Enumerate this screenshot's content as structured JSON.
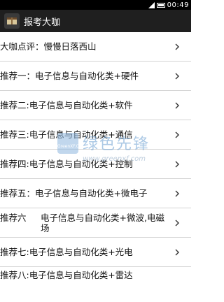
{
  "status_bar": {
    "time": "00:49"
  },
  "action_bar": {
    "title": "报考大咖"
  },
  "list": {
    "items": [
      {
        "label": "大咖点评：慢慢日落西山"
      },
      {
        "label": "推荐一：电子信息与自动化类+硬件"
      },
      {
        "label": "推荐二:电子信息与自动化类+软件"
      },
      {
        "label": "推荐三:电子信息与自动化类+通信"
      },
      {
        "label": "推荐四:电子信息与自动化类+控制"
      },
      {
        "label": "推荐五：电子信息与自动化类+微电子"
      },
      {
        "label_left": "推荐六",
        "label_right": "电子信息与自动化类+微波,电磁场"
      },
      {
        "label": "推荐七:电子信息与自动化类+光电"
      },
      {
        "label": "推荐八:电子信息与自动化类+雷达"
      }
    ]
  },
  "watermark": {
    "title": "绿色先锋",
    "url": "www.greenxf.com",
    "logo_text": "GreenXF.COM"
  },
  "icons": {
    "chevron": "chevron-right-icon",
    "app": "app-logo-icon"
  },
  "colors": {
    "action_bar": "#1f1f1f",
    "status_bar": "#000000",
    "divider": "#d4d4d4"
  }
}
